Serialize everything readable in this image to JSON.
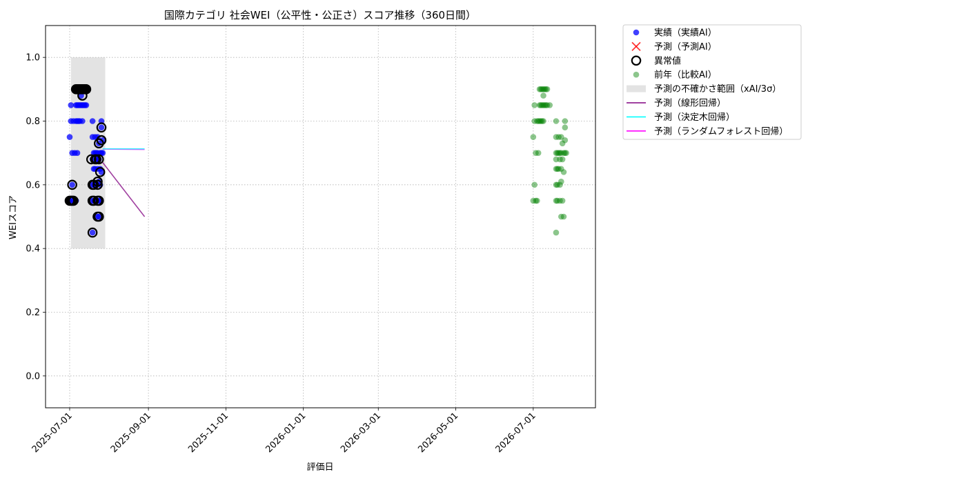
{
  "chart_data": {
    "type": "scatter",
    "title": "国際カテゴリ 社会WEI（公平性・公正さ）スコア推移（360日間）",
    "xlabel": "評価日",
    "ylabel": "WEIスコア",
    "xlim": [
      "2025-06-12",
      "2026-08-19"
    ],
    "ylim": [
      -0.1,
      1.1
    ],
    "xticks": [
      "2025-07-01",
      "2025-09-01",
      "2025-11-01",
      "2026-01-01",
      "2026-03-01",
      "2026-05-01",
      "2026-07-01"
    ],
    "yticks": [
      "0.0",
      "0.2",
      "0.4",
      "0.6",
      "0.8",
      "1.0"
    ],
    "grid": true,
    "legend_position": "outside-right-top",
    "legend": [
      {
        "label": "実績（実績AI）",
        "kind": "dot",
        "color": "#0000ff"
      },
      {
        "label": "予測（予測AI）",
        "kind": "x",
        "color": "#ff0000"
      },
      {
        "label": "異常値",
        "kind": "ring",
        "color": "#000000"
      },
      {
        "label": "前年（比較AI）",
        "kind": "dot-faded",
        "color": "#008000"
      },
      {
        "label": "予測の不確かさ範囲（xAI/3σ）",
        "kind": "band",
        "color": "#c8c8c8"
      },
      {
        "label": "予測（線形回帰）",
        "kind": "line",
        "color": "#800080"
      },
      {
        "label": "予測（決定木回帰）",
        "kind": "line",
        "color": "#00ffff"
      },
      {
        "label": "予測（ランダムフォレスト回帰）",
        "kind": "line",
        "color": "#ff00ff"
      }
    ],
    "uncertainty_band": {
      "x": [
        "2025-07-02",
        "2025-07-29"
      ],
      "y": [
        0.4,
        1.0
      ]
    },
    "actual": {
      "name": "実績（実績AI）",
      "color": "#0000ff",
      "points": [
        [
          "2025-07-01",
          0.55
        ],
        [
          "2025-07-01",
          0.75
        ],
        [
          "2025-07-02",
          0.85
        ],
        [
          "2025-07-02",
          0.8
        ],
        [
          "2025-07-02",
          0.55
        ],
        [
          "2025-07-03",
          0.7
        ],
        [
          "2025-07-03",
          0.6
        ],
        [
          "2025-07-04",
          0.8
        ],
        [
          "2025-07-04",
          0.55
        ],
        [
          "2025-07-05",
          0.9
        ],
        [
          "2025-07-05",
          0.7
        ],
        [
          "2025-07-06",
          0.85
        ],
        [
          "2025-07-06",
          0.8
        ],
        [
          "2025-07-06",
          0.55
        ],
        [
          "2025-07-07",
          0.9
        ],
        [
          "2025-07-07",
          0.85
        ],
        [
          "2025-07-07",
          0.8
        ],
        [
          "2025-07-07",
          0.7
        ],
        [
          "2025-07-08",
          0.9
        ],
        [
          "2025-07-08",
          0.85
        ],
        [
          "2025-07-08",
          0.8
        ],
        [
          "2025-07-09",
          0.9
        ],
        [
          "2025-07-09",
          0.85
        ],
        [
          "2025-07-09",
          0.8
        ],
        [
          "2025-07-10",
          0.9
        ],
        [
          "2025-07-10",
          0.88
        ],
        [
          "2025-07-10",
          0.85
        ],
        [
          "2025-07-11",
          0.9
        ],
        [
          "2025-07-11",
          0.85
        ],
        [
          "2025-07-11",
          0.8
        ],
        [
          "2025-07-12",
          0.9
        ],
        [
          "2025-07-12",
          0.85
        ],
        [
          "2025-07-13",
          0.9
        ],
        [
          "2025-07-13",
          0.85
        ],
        [
          "2025-07-14",
          0.9
        ],
        [
          "2025-07-14",
          0.85
        ],
        [
          "2025-07-19",
          0.8
        ],
        [
          "2025-07-19",
          0.75
        ],
        [
          "2025-07-19",
          0.68
        ],
        [
          "2025-07-19",
          0.6
        ],
        [
          "2025-07-19",
          0.55
        ],
        [
          "2025-07-19",
          0.45
        ],
        [
          "2025-07-20",
          0.7
        ],
        [
          "2025-07-20",
          0.65
        ],
        [
          "2025-07-20",
          0.6
        ],
        [
          "2025-07-20",
          0.55
        ],
        [
          "2025-07-21",
          0.75
        ],
        [
          "2025-07-21",
          0.7
        ],
        [
          "2025-07-21",
          0.65
        ],
        [
          "2025-07-21",
          0.55
        ],
        [
          "2025-07-22",
          0.7
        ],
        [
          "2025-07-22",
          0.68
        ],
        [
          "2025-07-22",
          0.6
        ],
        [
          "2025-07-22",
          0.55
        ],
        [
          "2025-07-23",
          0.75
        ],
        [
          "2025-07-23",
          0.7
        ],
        [
          "2025-07-23",
          0.68
        ],
        [
          "2025-07-23",
          0.65
        ],
        [
          "2025-07-23",
          0.55
        ],
        [
          "2025-07-23",
          0.5
        ],
        [
          "2025-07-24",
          0.73
        ],
        [
          "2025-07-24",
          0.68
        ],
        [
          "2025-07-24",
          0.61
        ],
        [
          "2025-07-24",
          0.55
        ],
        [
          "2025-07-24",
          0.5
        ],
        [
          "2025-07-25",
          0.7
        ],
        [
          "2025-07-25",
          0.65
        ],
        [
          "2025-07-25",
          0.6
        ],
        [
          "2025-07-25",
          0.55
        ],
        [
          "2025-07-26",
          0.8
        ],
        [
          "2025-07-26",
          0.78
        ],
        [
          "2025-07-26",
          0.7
        ],
        [
          "2025-07-26",
          0.64
        ],
        [
          "2025-07-27",
          0.74
        ],
        [
          "2025-07-27",
          0.7
        ]
      ]
    },
    "anomalies": {
      "name": "異常値",
      "points": [
        [
          "2025-07-01",
          0.55
        ],
        [
          "2025-07-02",
          0.55
        ],
        [
          "2025-07-03",
          0.55
        ],
        [
          "2025-07-04",
          0.55
        ],
        [
          "2025-07-03",
          0.6
        ],
        [
          "2025-07-06",
          0.9
        ],
        [
          "2025-07-07",
          0.9
        ],
        [
          "2025-07-08",
          0.9
        ],
        [
          "2025-07-09",
          0.9
        ],
        [
          "2025-07-10",
          0.9
        ],
        [
          "2025-07-11",
          0.9
        ],
        [
          "2025-07-12",
          0.9
        ],
        [
          "2025-07-13",
          0.9
        ],
        [
          "2025-07-14",
          0.9
        ],
        [
          "2025-07-11",
          0.88
        ],
        [
          "2025-07-18",
          0.68
        ],
        [
          "2025-07-19",
          0.6
        ],
        [
          "2025-07-19",
          0.55
        ],
        [
          "2025-07-19",
          0.45
        ],
        [
          "2025-07-20",
          0.6
        ],
        [
          "2025-07-20",
          0.55
        ],
        [
          "2025-07-21",
          0.68
        ],
        [
          "2025-07-22",
          0.68
        ],
        [
          "2025-07-23",
          0.61
        ],
        [
          "2025-07-23",
          0.6
        ],
        [
          "2025-07-23",
          0.55
        ],
        [
          "2025-07-23",
          0.5
        ],
        [
          "2025-07-24",
          0.73
        ],
        [
          "2025-07-24",
          0.68
        ],
        [
          "2025-07-24",
          0.55
        ],
        [
          "2025-07-24",
          0.5
        ],
        [
          "2025-07-25",
          0.64
        ],
        [
          "2025-07-26",
          0.78
        ],
        [
          "2025-07-26",
          0.74
        ]
      ]
    },
    "previous_year": {
      "name": "前年（比較AI）",
      "color": "#008000",
      "points": [
        [
          "2026-07-01",
          0.55
        ],
        [
          "2026-07-01",
          0.75
        ],
        [
          "2026-07-02",
          0.85
        ],
        [
          "2026-07-02",
          0.8
        ],
        [
          "2026-07-02",
          0.6
        ],
        [
          "2026-07-03",
          0.7
        ],
        [
          "2026-07-03",
          0.55
        ],
        [
          "2026-07-04",
          0.8
        ],
        [
          "2026-07-04",
          0.55
        ],
        [
          "2026-07-05",
          0.7
        ],
        [
          "2026-07-05",
          0.8
        ],
        [
          "2026-07-06",
          0.9
        ],
        [
          "2026-07-06",
          0.85
        ],
        [
          "2026-07-06",
          0.8
        ],
        [
          "2026-07-07",
          0.9
        ],
        [
          "2026-07-07",
          0.85
        ],
        [
          "2026-07-07",
          0.8
        ],
        [
          "2026-07-08",
          0.9
        ],
        [
          "2026-07-08",
          0.85
        ],
        [
          "2026-07-08",
          0.8
        ],
        [
          "2026-07-09",
          0.9
        ],
        [
          "2026-07-09",
          0.88
        ],
        [
          "2026-07-09",
          0.85
        ],
        [
          "2026-07-09",
          0.8
        ],
        [
          "2026-07-10",
          0.9
        ],
        [
          "2026-07-10",
          0.85
        ],
        [
          "2026-07-11",
          0.9
        ],
        [
          "2026-07-11",
          0.85
        ],
        [
          "2026-07-12",
          0.9
        ],
        [
          "2026-07-12",
          0.85
        ],
        [
          "2026-07-14",
          0.85
        ],
        [
          "2026-07-19",
          0.8
        ],
        [
          "2026-07-19",
          0.75
        ],
        [
          "2026-07-19",
          0.7
        ],
        [
          "2026-07-19",
          0.68
        ],
        [
          "2026-07-19",
          0.65
        ],
        [
          "2026-07-19",
          0.6
        ],
        [
          "2026-07-19",
          0.55
        ],
        [
          "2026-07-19",
          0.45
        ],
        [
          "2026-07-20",
          0.7
        ],
        [
          "2026-07-20",
          0.65
        ],
        [
          "2026-07-20",
          0.6
        ],
        [
          "2026-07-20",
          0.55
        ],
        [
          "2026-07-21",
          0.75
        ],
        [
          "2026-07-21",
          0.7
        ],
        [
          "2026-07-21",
          0.65
        ],
        [
          "2026-07-22",
          0.7
        ],
        [
          "2026-07-22",
          0.68
        ],
        [
          "2026-07-22",
          0.6
        ],
        [
          "2026-07-22",
          0.55
        ],
        [
          "2026-07-23",
          0.75
        ],
        [
          "2026-07-23",
          0.7
        ],
        [
          "2026-07-23",
          0.65
        ],
        [
          "2026-07-23",
          0.61
        ],
        [
          "2026-07-23",
          0.5
        ],
        [
          "2026-07-24",
          0.73
        ],
        [
          "2026-07-24",
          0.68
        ],
        [
          "2026-07-24",
          0.55
        ],
        [
          "2026-07-25",
          0.7
        ],
        [
          "2026-07-25",
          0.64
        ],
        [
          "2026-07-25",
          0.5
        ],
        [
          "2026-07-26",
          0.8
        ],
        [
          "2026-07-26",
          0.78
        ],
        [
          "2026-07-26",
          0.74
        ],
        [
          "2026-07-26",
          0.7
        ],
        [
          "2026-07-27",
          0.7
        ]
      ]
    },
    "forecast_lines": [
      {
        "name": "予測（ランダムフォレスト回帰）",
        "color": "#ff00ff",
        "points": [
          [
            "2025-07-27",
            0.712
          ],
          [
            "2025-08-29",
            0.711
          ]
        ]
      },
      {
        "name": "予測（決定木回帰）",
        "color": "#00ffff",
        "points": [
          [
            "2025-07-27",
            0.713
          ],
          [
            "2025-08-29",
            0.713
          ]
        ]
      },
      {
        "name": "予測（線形回帰）",
        "color": "#800080",
        "points": [
          [
            "2025-07-27",
            0.67
          ],
          [
            "2025-08-29",
            0.5
          ]
        ]
      }
    ]
  }
}
